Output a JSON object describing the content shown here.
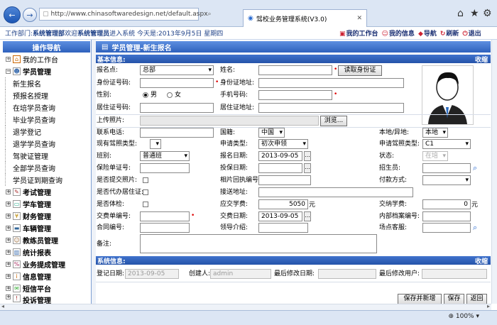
{
  "browser": {
    "url": "http://www.chinasoftwaredesign.net/default.aspx",
    "tab_title": "驾校业务管理系统(V3.0)",
    "zoom": "100%"
  },
  "header": {
    "text_prefix": "工作部门:",
    "department": "系统管理部",
    "welcome_prefix": " 欢迎",
    "user": "系统管理员",
    "welcome_suffix": "进入系统  今天是:2013年9月5日 星期四",
    "links": [
      "我的工作台",
      "我的信息",
      "导航",
      "刷新",
      "退出"
    ]
  },
  "sidebar": {
    "title": "操作导航",
    "workbench": "我的工作台",
    "student_group": "学员管理",
    "student_items": [
      "新生报名",
      "预报名授理",
      "在培学员查询",
      "毕业学员查询",
      "退学登记",
      "退学学员查询",
      "驾驶证管理",
      "全部学员查询",
      "学员证到期查询"
    ],
    "groups": [
      "考试管理",
      "学车管理",
      "财务管理",
      "车辆管理",
      "教练员管理",
      "统计报表",
      "业务提成管理",
      "信息管理",
      "短信平台",
      "投诉管理"
    ]
  },
  "page_title": "学员管理-新生报名",
  "basic": {
    "section": "基本信息:",
    "collapse": "收缩",
    "labels": {
      "signup_point": "报名点:",
      "name": "姓名:",
      "id_no": "身份证号码:",
      "id_addr": "身份证地址:",
      "gender": "性别:",
      "mobile": "手机号码:",
      "residence_no": "居住证号码:",
      "residence_addr": "居住证地址:",
      "photo": "上传照片:",
      "phone": "联系电话:",
      "nationality": "国籍:",
      "local": "本地/异地:",
      "cur_license": "现有驾照类型:",
      "apply_type": "申请类型:",
      "apply_license": "申请驾照类型:",
      "class": "班别:",
      "signup_date": "报名日期:",
      "status": "状态:",
      "insurance_no": "保险单证号:",
      "insure_date": "投保日期:",
      "recruiter": "招生员:",
      "photo_submitted": "是否提交照片:",
      "photo_receipt": "相片回执编号:",
      "pay_method": "付款方式:",
      "residence_proxy": "是否代办居住证:",
      "pickup_addr": "接送地址:",
      "physical": "是否体检:",
      "fee_due": "应交学费:",
      "fee_paid": "交纳学费:",
      "payment_no": "交费单编号:",
      "payment_date": "交费日期:",
      "archive_no": "内部档案编号:",
      "contract_no": "合同编号:",
      "leader": "领导介绍:",
      "site_service": "场点客服:",
      "remark": "备注:"
    },
    "values": {
      "signup_point": "总部",
      "read_id_btn": "读取身份证",
      "gender_male": "男",
      "gender_female": "女",
      "browse_btn": "浏览...",
      "nationality": "中国",
      "local": "本地",
      "apply_type": "初次申领",
      "apply_license": "C1",
      "class": "普通班",
      "signup_date": "2013-09-05",
      "status": "在培",
      "fee_due": "5050",
      "fee_unit": "元",
      "fee_paid": "0",
      "payment_date": "2013-09-05",
      "date_btn": "..."
    }
  },
  "system": {
    "section": "系统信息:",
    "collapse": "收缩",
    "reg_date_label": "登记日期:",
    "reg_date": "2013-09-05",
    "creator_label": "创建人:",
    "creator": "admin",
    "modified_date_label": "最后修改日期:",
    "modified_user_label": "最后修改用户:"
  },
  "actions": {
    "save_new": "保存并新增",
    "save": "保存",
    "back": "返回"
  }
}
